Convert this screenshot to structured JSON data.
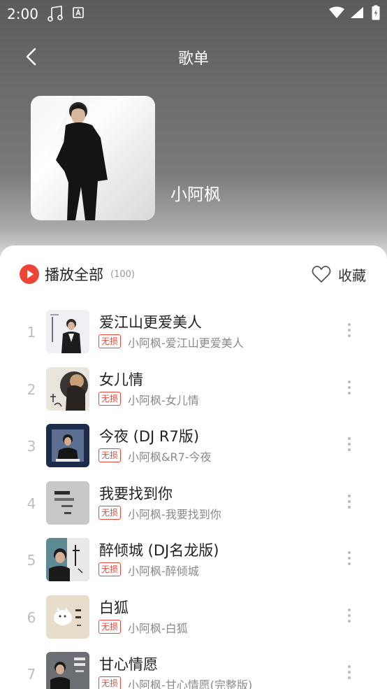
{
  "status_bar": {
    "time": "2:00"
  },
  "header": {
    "title": "歌单"
  },
  "playlist": {
    "cover_name": "小阿枫"
  },
  "controls": {
    "play_all_label": "播放全部",
    "count": "(100)",
    "collect_label": "收藏"
  },
  "colors": {
    "accent": "#ef4336",
    "badge": "#e8483c"
  },
  "songs": [
    {
      "index": "1",
      "title": "爱江山更爱美人",
      "badge": "无损",
      "subtitle": "小阿枫-爱江山更爱美人"
    },
    {
      "index": "2",
      "title": "女儿情",
      "badge": "无损",
      "subtitle": "小阿枫-女儿情"
    },
    {
      "index": "3",
      "title": "今夜 (DJ R7版)",
      "badge": "无损",
      "subtitle": "小阿枫&R7-今夜"
    },
    {
      "index": "4",
      "title": "我要找到你",
      "badge": "无损",
      "subtitle": "小阿枫-我要找到你"
    },
    {
      "index": "5",
      "title": "醉倾城 (DJ名龙版)",
      "badge": "无损",
      "subtitle": "小阿枫-醉倾城"
    },
    {
      "index": "6",
      "title": "白狐",
      "badge": "无损",
      "subtitle": "小阿枫-白狐"
    },
    {
      "index": "7",
      "title": "甘心情愿",
      "badge": "无损",
      "subtitle": "小阿枫-甘心情愿(完整版)"
    }
  ]
}
